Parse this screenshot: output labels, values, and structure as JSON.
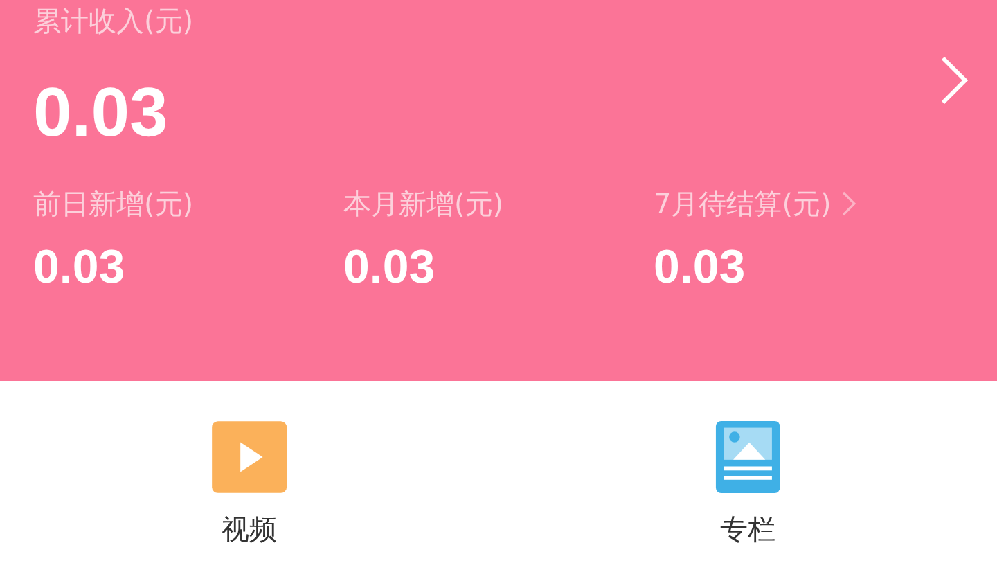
{
  "total": {
    "label": "累计收入(元)",
    "value": "0.03"
  },
  "stats": [
    {
      "label": "前日新增(元)",
      "value": "0.03",
      "link": false
    },
    {
      "label": "本月新增(元)",
      "value": "0.03",
      "link": false
    },
    {
      "label": "7月待结算(元)",
      "value": "0.03",
      "link": true
    }
  ],
  "shortcuts": [
    {
      "label": "视频",
      "kind": "video"
    },
    {
      "label": "专栏",
      "kind": "article"
    }
  ]
}
